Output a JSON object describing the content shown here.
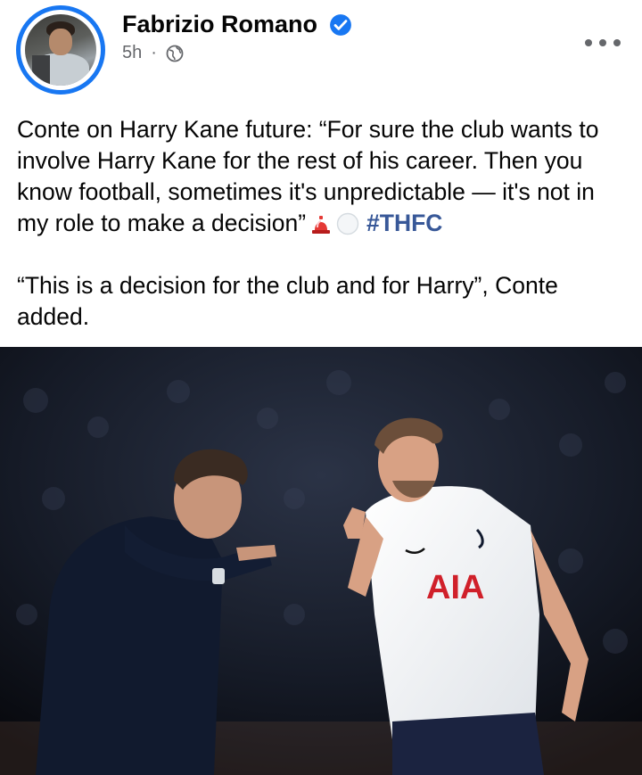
{
  "post": {
    "author_name": "Fabrizio Romano",
    "time": "5h",
    "separator": "·",
    "privacy_icon": "globe-icon",
    "verified_icon": "verified-badge-icon",
    "more_icon": "more-options-icon",
    "text_line1_a": "Conte on Harry Kane future: “For sure the club wants to involve Harry Kane for the rest of his career. Then you know football, sometimes it's unpredictable — it's not in my role to make a decision”",
    "hashtag": "#THFC",
    "text_paragraph2": "“This is a decision for the club and for Harry”, Conte added."
  },
  "photo": {
    "jersey_sponsor": "AIA"
  },
  "colors": {
    "accent": "#1877f2",
    "hashtag": "#385898",
    "meta_text": "#65676b"
  }
}
